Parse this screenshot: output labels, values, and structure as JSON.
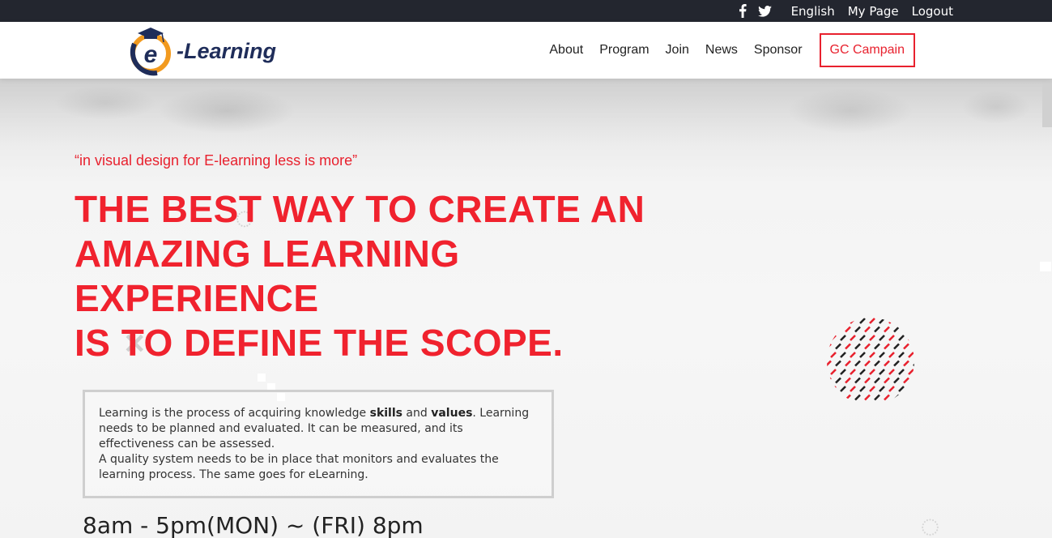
{
  "topbar": {
    "social": [
      "facebook-icon",
      "twitter-icon"
    ],
    "language": "English",
    "my_page": "My Page",
    "logout": "Logout"
  },
  "header": {
    "logo_text": "-Learning",
    "logo_letter": "e",
    "nav": [
      "About",
      "Program",
      "Join",
      "News",
      "Sponsor"
    ],
    "campaign": "GC Campain"
  },
  "hero": {
    "quote": "“in visual design for E-learning less is more”",
    "headline": [
      "THE BEST WAY TO CREATE AN",
      "AMAZING LEARNING",
      "EXPERIENCE",
      "IS TO DEFINE THE SCOPE."
    ],
    "info": {
      "p1_a": "Learning is the process of acquiring knowledge ",
      "p1_b": "skills",
      "p1_c": " and ",
      "p1_d": "values",
      "p1_e": ". Learning needs to be planned and evaluated. It can be measured, and its effectiveness can be assessed.",
      "p2": "A quality system needs to be in place that monitors and evaluates the learning process. The same goes for eLearning."
    },
    "hours": "8am - 5pm(MON) ~ (FRI) 8pm"
  },
  "colors": {
    "accent": "#e8212e",
    "topbar": "#23262f",
    "logo_blue": "#1f2d5a",
    "logo_orange": "#f29a1f"
  }
}
